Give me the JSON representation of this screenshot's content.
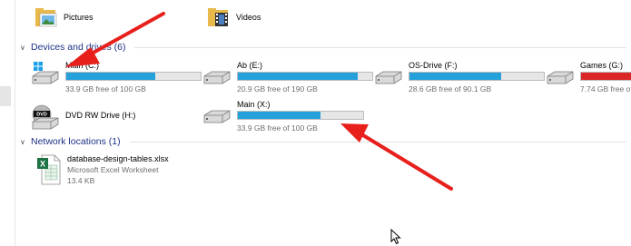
{
  "folders": [
    {
      "label": "Pictures",
      "icon": "pictures-folder-icon"
    },
    {
      "label": "Videos",
      "icon": "videos-folder-icon"
    }
  ],
  "groups": {
    "devices": {
      "label": "Devices and drives (6)"
    },
    "network": {
      "label": "Network locations (1)"
    }
  },
  "drives": [
    {
      "name": "Main (C:)",
      "free": "33.9 GB free of 100 GB",
      "used_fraction": 0.66,
      "color": "#26a0da",
      "icon": "windows-drive-icon"
    },
    {
      "name": "Ab (E:)",
      "free": "20.9 GB free of 190 GB",
      "used_fraction": 0.89,
      "color": "#26a0da",
      "icon": "hard-drive-icon"
    },
    {
      "name": "OS-Drive (F:)",
      "free": "28.6 GB free of 90.1 GB",
      "used_fraction": 0.68,
      "color": "#26a0da",
      "icon": "hard-drive-icon"
    },
    {
      "name": "Games (G:)",
      "free": "7.74 GB free of",
      "used_fraction": 0.96,
      "color": "#da2626",
      "icon": "hard-drive-icon"
    },
    {
      "name": "DVD RW Drive (H:)",
      "icon": "dvd-drive-icon"
    },
    {
      "name": "Main (X:)",
      "free": "33.9 GB free of 100 GB",
      "used_fraction": 0.66,
      "color": "#26a0da",
      "icon": "hard-drive-icon"
    }
  ],
  "network_items": [
    {
      "name": "database-design-tables.xlsx",
      "type": "Microsoft Excel Worksheet",
      "size": "13.4 KB",
      "icon": "excel-file-icon"
    }
  ],
  "annotation": {
    "arrow_color": "#e8201c"
  }
}
